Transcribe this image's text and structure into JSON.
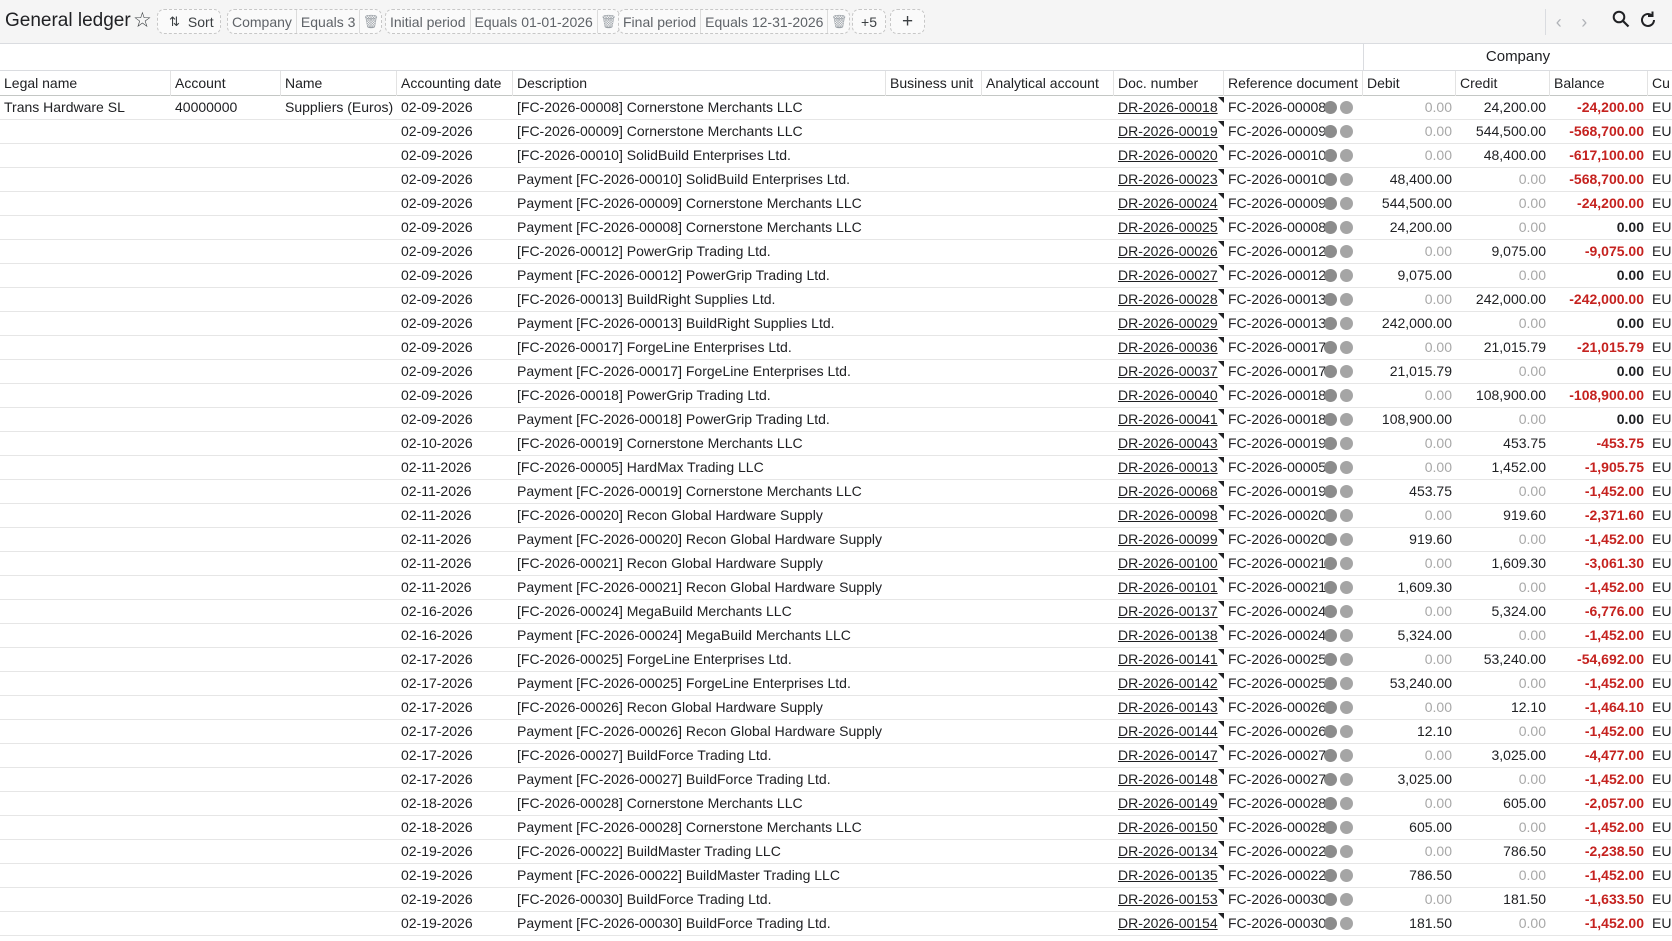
{
  "app": {
    "title": "General ledger"
  },
  "toolbar": {
    "sort_label": "Sort",
    "filters": [
      {
        "field": "Company",
        "value": "Equals 3"
      },
      {
        "field": "Initial period",
        "value": "Equals 01-01-2026"
      },
      {
        "field": "Final period",
        "value": "Equals 12-31-2026"
      }
    ],
    "more_filters": "+5",
    "add_label": "+"
  },
  "icons": {
    "star": "star-outline-icon",
    "sort": "sort-arrows-icon",
    "trash": "trash-icon",
    "prev": "chevron-left-icon",
    "next": "chevron-right-icon",
    "search": "search-icon",
    "refresh": "refresh-icon"
  },
  "colors": {
    "negative": "#c5221f",
    "zero": "#a8a8a8",
    "status_dot": "#8c8c8c"
  },
  "group_header": "Company",
  "columns": [
    "Legal name",
    "Account",
    "Name",
    "Accounting date",
    "Description",
    "Business unit",
    "Analytical account",
    "Doc. number",
    "Reference document",
    "Debit",
    "Credit",
    "Balance",
    "Cu"
  ],
  "rows": [
    {
      "legal": "Trans Hardware SL",
      "account": "40000000",
      "name": "Suppliers (Euros)",
      "date": "02-09-2026",
      "desc": "[FC-2026-00008] Cornerstone Merchants LLC",
      "doc": "DR-2026-00018",
      "ref": "FC-2026-00008",
      "debit": "0.00",
      "credit": "24,200.00",
      "balance": "-24,200.00",
      "cur": "EU"
    },
    {
      "legal": "",
      "account": "",
      "name": "",
      "date": "02-09-2026",
      "desc": "[FC-2026-00009] Cornerstone Merchants LLC",
      "doc": "DR-2026-00019",
      "ref": "FC-2026-00009",
      "debit": "0.00",
      "credit": "544,500.00",
      "balance": "-568,700.00",
      "cur": "EU"
    },
    {
      "legal": "",
      "account": "",
      "name": "",
      "date": "02-09-2026",
      "desc": "[FC-2026-00010] SolidBuild Enterprises Ltd.",
      "doc": "DR-2026-00020",
      "ref": "FC-2026-00010",
      "debit": "0.00",
      "credit": "48,400.00",
      "balance": "-617,100.00",
      "cur": "EU"
    },
    {
      "legal": "",
      "account": "",
      "name": "",
      "date": "02-09-2026",
      "desc": "Payment [FC-2026-00010] SolidBuild Enterprises Ltd.",
      "doc": "DR-2026-00023",
      "ref": "FC-2026-00010",
      "debit": "48,400.00",
      "credit": "0.00",
      "balance": "-568,700.00",
      "cur": "EU"
    },
    {
      "legal": "",
      "account": "",
      "name": "",
      "date": "02-09-2026",
      "desc": "Payment [FC-2026-00009] Cornerstone Merchants LLC",
      "doc": "DR-2026-00024",
      "ref": "FC-2026-00009",
      "debit": "544,500.00",
      "credit": "0.00",
      "balance": "-24,200.00",
      "cur": "EU"
    },
    {
      "legal": "",
      "account": "",
      "name": "",
      "date": "02-09-2026",
      "desc": "Payment [FC-2026-00008] Cornerstone Merchants LLC",
      "doc": "DR-2026-00025",
      "ref": "FC-2026-00008",
      "debit": "24,200.00",
      "credit": "0.00",
      "balance": "0.00",
      "cur": "EU"
    },
    {
      "legal": "",
      "account": "",
      "name": "",
      "date": "02-09-2026",
      "desc": "[FC-2026-00012] PowerGrip Trading Ltd.",
      "doc": "DR-2026-00026",
      "ref": "FC-2026-00012",
      "debit": "0.00",
      "credit": "9,075.00",
      "balance": "-9,075.00",
      "cur": "EU"
    },
    {
      "legal": "",
      "account": "",
      "name": "",
      "date": "02-09-2026",
      "desc": "Payment [FC-2026-00012] PowerGrip Trading Ltd.",
      "doc": "DR-2026-00027",
      "ref": "FC-2026-00012",
      "debit": "9,075.00",
      "credit": "0.00",
      "balance": "0.00",
      "cur": "EU"
    },
    {
      "legal": "",
      "account": "",
      "name": "",
      "date": "02-09-2026",
      "desc": "[FC-2026-00013] BuildRight Supplies Ltd.",
      "doc": "DR-2026-00028",
      "ref": "FC-2026-00013",
      "debit": "0.00",
      "credit": "242,000.00",
      "balance": "-242,000.00",
      "cur": "EU"
    },
    {
      "legal": "",
      "account": "",
      "name": "",
      "date": "02-09-2026",
      "desc": "Payment [FC-2026-00013] BuildRight Supplies Ltd.",
      "doc": "DR-2026-00029",
      "ref": "FC-2026-00013",
      "debit": "242,000.00",
      "credit": "0.00",
      "balance": "0.00",
      "cur": "EU"
    },
    {
      "legal": "",
      "account": "",
      "name": "",
      "date": "02-09-2026",
      "desc": "[FC-2026-00017] ForgeLine Enterprises Ltd.",
      "doc": "DR-2026-00036",
      "ref": "FC-2026-00017",
      "debit": "0.00",
      "credit": "21,015.79",
      "balance": "-21,015.79",
      "cur": "EU"
    },
    {
      "legal": "",
      "account": "",
      "name": "",
      "date": "02-09-2026",
      "desc": "Payment [FC-2026-00017] ForgeLine Enterprises Ltd.",
      "doc": "DR-2026-00037",
      "ref": "FC-2026-00017",
      "debit": "21,015.79",
      "credit": "0.00",
      "balance": "0.00",
      "cur": "EU"
    },
    {
      "legal": "",
      "account": "",
      "name": "",
      "date": "02-09-2026",
      "desc": "[FC-2026-00018] PowerGrip Trading Ltd.",
      "doc": "DR-2026-00040",
      "ref": "FC-2026-00018",
      "debit": "0.00",
      "credit": "108,900.00",
      "balance": "-108,900.00",
      "cur": "EU"
    },
    {
      "legal": "",
      "account": "",
      "name": "",
      "date": "02-09-2026",
      "desc": "Payment [FC-2026-00018] PowerGrip Trading Ltd.",
      "doc": "DR-2026-00041",
      "ref": "FC-2026-00018",
      "debit": "108,900.00",
      "credit": "0.00",
      "balance": "0.00",
      "cur": "EU"
    },
    {
      "legal": "",
      "account": "",
      "name": "",
      "date": "02-10-2026",
      "desc": "[FC-2026-00019] Cornerstone Merchants LLC",
      "doc": "DR-2026-00043",
      "ref": "FC-2026-00019",
      "debit": "0.00",
      "credit": "453.75",
      "balance": "-453.75",
      "cur": "EU"
    },
    {
      "legal": "",
      "account": "",
      "name": "",
      "date": "02-11-2026",
      "desc": "[FC-2026-00005] HardMax Trading LLC",
      "doc": "DR-2026-00013",
      "ref": "FC-2026-00005",
      "debit": "0.00",
      "credit": "1,452.00",
      "balance": "-1,905.75",
      "cur": "EU"
    },
    {
      "legal": "",
      "account": "",
      "name": "",
      "date": "02-11-2026",
      "desc": "Payment [FC-2026-00019] Cornerstone Merchants LLC",
      "doc": "DR-2026-00068",
      "ref": "FC-2026-00019",
      "debit": "453.75",
      "credit": "0.00",
      "balance": "-1,452.00",
      "cur": "EU"
    },
    {
      "legal": "",
      "account": "",
      "name": "",
      "date": "02-11-2026",
      "desc": "[FC-2026-00020] Recon Global Hardware Supply",
      "doc": "DR-2026-00098",
      "ref": "FC-2026-00020",
      "debit": "0.00",
      "credit": "919.60",
      "balance": "-2,371.60",
      "cur": "EU"
    },
    {
      "legal": "",
      "account": "",
      "name": "",
      "date": "02-11-2026",
      "desc": "Payment [FC-2026-00020] Recon Global Hardware Supply",
      "doc": "DR-2026-00099",
      "ref": "FC-2026-00020",
      "debit": "919.60",
      "credit": "0.00",
      "balance": "-1,452.00",
      "cur": "EU"
    },
    {
      "legal": "",
      "account": "",
      "name": "",
      "date": "02-11-2026",
      "desc": "[FC-2026-00021] Recon Global Hardware Supply",
      "doc": "DR-2026-00100",
      "ref": "FC-2026-00021",
      "debit": "0.00",
      "credit": "1,609.30",
      "balance": "-3,061.30",
      "cur": "EU"
    },
    {
      "legal": "",
      "account": "",
      "name": "",
      "date": "02-11-2026",
      "desc": "Payment [FC-2026-00021] Recon Global Hardware Supply",
      "doc": "DR-2026-00101",
      "ref": "FC-2026-00021",
      "debit": "1,609.30",
      "credit": "0.00",
      "balance": "-1,452.00",
      "cur": "EU"
    },
    {
      "legal": "",
      "account": "",
      "name": "",
      "date": "02-16-2026",
      "desc": "[FC-2026-00024] MegaBuild Merchants LLC",
      "doc": "DR-2026-00137",
      "ref": "FC-2026-00024",
      "debit": "0.00",
      "credit": "5,324.00",
      "balance": "-6,776.00",
      "cur": "EU"
    },
    {
      "legal": "",
      "account": "",
      "name": "",
      "date": "02-16-2026",
      "desc": "Payment [FC-2026-00024] MegaBuild Merchants LLC",
      "doc": "DR-2026-00138",
      "ref": "FC-2026-00024",
      "debit": "5,324.00",
      "credit": "0.00",
      "balance": "-1,452.00",
      "cur": "EU"
    },
    {
      "legal": "",
      "account": "",
      "name": "",
      "date": "02-17-2026",
      "desc": "[FC-2026-00025] ForgeLine Enterprises Ltd.",
      "doc": "DR-2026-00141",
      "ref": "FC-2026-00025",
      "debit": "0.00",
      "credit": "53,240.00",
      "balance": "-54,692.00",
      "cur": "EU"
    },
    {
      "legal": "",
      "account": "",
      "name": "",
      "date": "02-17-2026",
      "desc": "Payment [FC-2026-00025] ForgeLine Enterprises Ltd.",
      "doc": "DR-2026-00142",
      "ref": "FC-2026-00025",
      "debit": "53,240.00",
      "credit": "0.00",
      "balance": "-1,452.00",
      "cur": "EU"
    },
    {
      "legal": "",
      "account": "",
      "name": "",
      "date": "02-17-2026",
      "desc": "[FC-2026-00026] Recon Global Hardware Supply",
      "doc": "DR-2026-00143",
      "ref": "FC-2026-00026",
      "debit": "0.00",
      "credit": "12.10",
      "balance": "-1,464.10",
      "cur": "EU"
    },
    {
      "legal": "",
      "account": "",
      "name": "",
      "date": "02-17-2026",
      "desc": "Payment [FC-2026-00026] Recon Global Hardware Supply",
      "doc": "DR-2026-00144",
      "ref": "FC-2026-00026",
      "debit": "12.10",
      "credit": "0.00",
      "balance": "-1,452.00",
      "cur": "EU"
    },
    {
      "legal": "",
      "account": "",
      "name": "",
      "date": "02-17-2026",
      "desc": "[FC-2026-00027] BuildForce Trading Ltd.",
      "doc": "DR-2026-00147",
      "ref": "FC-2026-00027",
      "debit": "0.00",
      "credit": "3,025.00",
      "balance": "-4,477.00",
      "cur": "EU"
    },
    {
      "legal": "",
      "account": "",
      "name": "",
      "date": "02-17-2026",
      "desc": "Payment [FC-2026-00027] BuildForce Trading Ltd.",
      "doc": "DR-2026-00148",
      "ref": "FC-2026-00027",
      "debit": "3,025.00",
      "credit": "0.00",
      "balance": "-1,452.00",
      "cur": "EU"
    },
    {
      "legal": "",
      "account": "",
      "name": "",
      "date": "02-18-2026",
      "desc": "[FC-2026-00028] Cornerstone Merchants LLC",
      "doc": "DR-2026-00149",
      "ref": "FC-2026-00028",
      "debit": "0.00",
      "credit": "605.00",
      "balance": "-2,057.00",
      "cur": "EU"
    },
    {
      "legal": "",
      "account": "",
      "name": "",
      "date": "02-18-2026",
      "desc": "Payment [FC-2026-00028] Cornerstone Merchants LLC",
      "doc": "DR-2026-00150",
      "ref": "FC-2026-00028",
      "debit": "605.00",
      "credit": "0.00",
      "balance": "-1,452.00",
      "cur": "EU"
    },
    {
      "legal": "",
      "account": "",
      "name": "",
      "date": "02-19-2026",
      "desc": "[FC-2026-00022] BuildMaster Trading LLC",
      "doc": "DR-2026-00134",
      "ref": "FC-2026-00022",
      "debit": "0.00",
      "credit": "786.50",
      "balance": "-2,238.50",
      "cur": "EU"
    },
    {
      "legal": "",
      "account": "",
      "name": "",
      "date": "02-19-2026",
      "desc": "Payment [FC-2026-00022] BuildMaster Trading LLC",
      "doc": "DR-2026-00135",
      "ref": "FC-2026-00022",
      "debit": "786.50",
      "credit": "0.00",
      "balance": "-1,452.00",
      "cur": "EU"
    },
    {
      "legal": "",
      "account": "",
      "name": "",
      "date": "02-19-2026",
      "desc": "[FC-2026-00030] BuildForce Trading Ltd.",
      "doc": "DR-2026-00153",
      "ref": "FC-2026-00030",
      "debit": "0.00",
      "credit": "181.50",
      "balance": "-1,633.50",
      "cur": "EU"
    },
    {
      "legal": "",
      "account": "",
      "name": "",
      "date": "02-19-2026",
      "desc": "Payment [FC-2026-00030] BuildForce Trading Ltd.",
      "doc": "DR-2026-00154",
      "ref": "FC-2026-00030",
      "debit": "181.50",
      "credit": "0.00",
      "balance": "-1,452.00",
      "cur": "EU"
    }
  ]
}
